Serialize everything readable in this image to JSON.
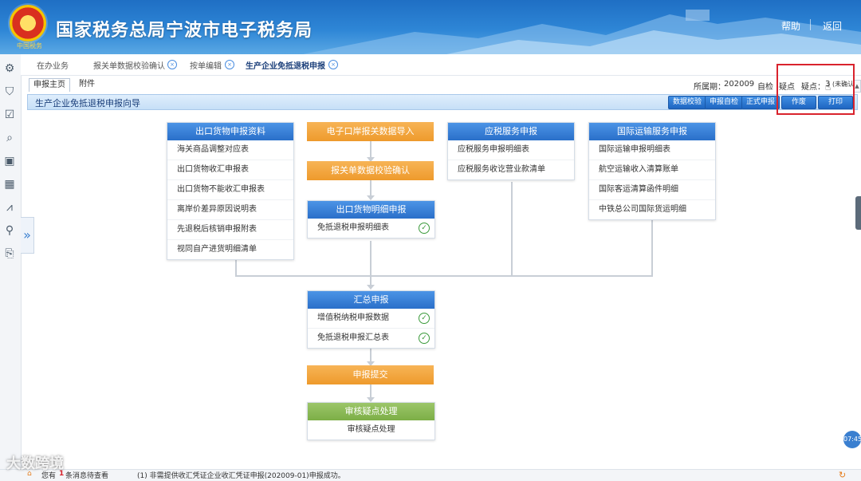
{
  "header": {
    "logo_sub": "中国税务",
    "title": "国家税务总局宁波市电子税务局",
    "help": "帮助",
    "back": "返回"
  },
  "nav": {
    "items": [
      "在办业务",
      "报关单数据校验确认",
      "按单编辑",
      "生产企业免抵退税申报"
    ]
  },
  "subtabs": [
    "申报主页",
    "附件"
  ],
  "period": {
    "label": "所属期：",
    "value": "202009",
    "self_check": "自检",
    "self_check_suffix": "疑点",
    "doubt_label": "疑点：",
    "doubt_value": "3",
    "doubt_note": "(未确认)"
  },
  "wizard": {
    "title": "生产企业免抵退税申报向导",
    "buttons": [
      "数据校验",
      "申报自检",
      "正式申报",
      "作废",
      "打印"
    ]
  },
  "flow": {
    "export_goods": {
      "title": "出口货物申报资料",
      "rows": [
        "海关商品调整对应表",
        "出口货物收汇申报表",
        "出口货物不能收汇申报表",
        "离岸价差异原因说明表",
        "先退税后核销申报附表",
        "视同自产进货明细清单"
      ]
    },
    "port_import": {
      "title": "电子口岸报关数据导入"
    },
    "customs_confirm": {
      "title": "报关单数据校验确认"
    },
    "export_detail": {
      "title": "出口货物明细申报",
      "rows": [
        "免抵退税申报明细表"
      ]
    },
    "taxable_service": {
      "title": "应税服务申报",
      "rows": [
        "应税服务申报明细表",
        "应税服务收讫营业款清单"
      ]
    },
    "intl_transport": {
      "title": "国际运输服务申报",
      "rows": [
        "国际运输申报明细表",
        "航空运输收入清算账单",
        "国际客运清算函件明细",
        "中铁总公司国际货运明细"
      ]
    },
    "summary": {
      "title": "汇总申报",
      "rows": [
        "增值税纳税申报数据",
        "免抵退税申报汇总表"
      ]
    },
    "submit": {
      "title": "申报提交"
    },
    "review": {
      "title": "审核疑点处理",
      "rows": [
        "审核疑点处理"
      ]
    }
  },
  "footer": {
    "msg_prefix": "您有",
    "msg_count": "1",
    "msg_suffix": "条消息待查看",
    "notice": "(1)  非需提供收汇凭证企业收汇凭证申报(202009-01)申报成功。"
  },
  "watermark": "大数跨境",
  "clock": "07:45",
  "colors": {
    "accent": "#2a6fc9",
    "orange": "#ee9a2c",
    "green": "#7cae46",
    "highlight": "#d9232d"
  }
}
